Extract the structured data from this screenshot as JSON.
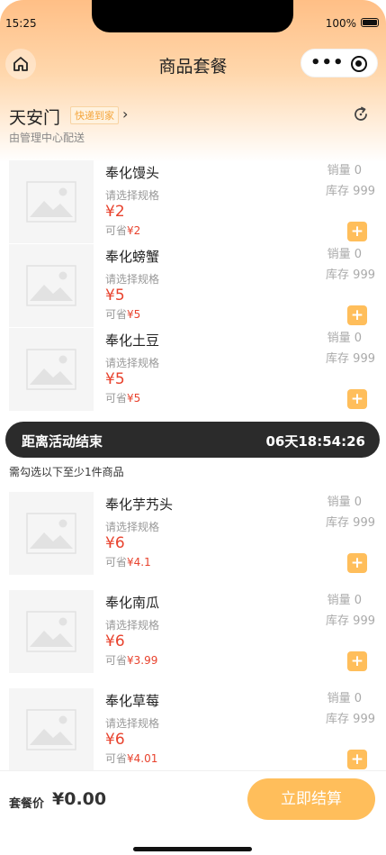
{
  "status_bar": {
    "time": "15:25",
    "battery": "100%"
  },
  "nav": {
    "title": "商品套餐"
  },
  "store": {
    "name": "天安门",
    "tag": "快递到家",
    "subtitle": "由管理中心配送"
  },
  "labels": {
    "sales": "销量",
    "stock": "库存",
    "save": "可省"
  },
  "products_top": [
    {
      "name": "奉化馒头",
      "spec": "请选择规格",
      "price": "¥2",
      "save": "¥2",
      "sales": "0",
      "stock": "999"
    },
    {
      "name": "奉化螃蟹",
      "spec": "请选择规格",
      "price": "¥5",
      "save": "¥5",
      "sales": "0",
      "stock": "999"
    },
    {
      "name": "奉化土豆",
      "spec": "请选择规格",
      "price": "¥5",
      "save": "¥5",
      "sales": "0",
      "stock": "999"
    }
  ],
  "countdown": {
    "label": "距离活动结束",
    "time": "06天18:54:26"
  },
  "hint": "需勾选以下至少1件商品",
  "products_bottom": [
    {
      "name": "奉化芋艿头",
      "spec": "请选择规格",
      "price": "¥6",
      "save": "¥4.1",
      "sales": "0",
      "stock": "999"
    },
    {
      "name": "奉化南瓜",
      "spec": "请选择规格",
      "price": "¥6",
      "save": "¥3.99",
      "sales": "0",
      "stock": "999"
    },
    {
      "name": "奉化草莓",
      "spec": "请选择规格",
      "price": "¥6",
      "save": "¥4.01",
      "sales": "0",
      "stock": "999"
    }
  ],
  "footer": {
    "total_label": "套餐价",
    "total_value": "¥0.00",
    "checkout": "立即结算"
  },
  "colors": {
    "accent": "#ffbe5b",
    "price": "#e8422d",
    "countdown_bg": "#2b2b2b"
  },
  "icons": {
    "home": "home-icon",
    "more": "more-dots-icon",
    "close": "target-icon",
    "refresh": "refresh-icon",
    "add": "plus-icon",
    "placeholder": "image-placeholder-icon"
  }
}
